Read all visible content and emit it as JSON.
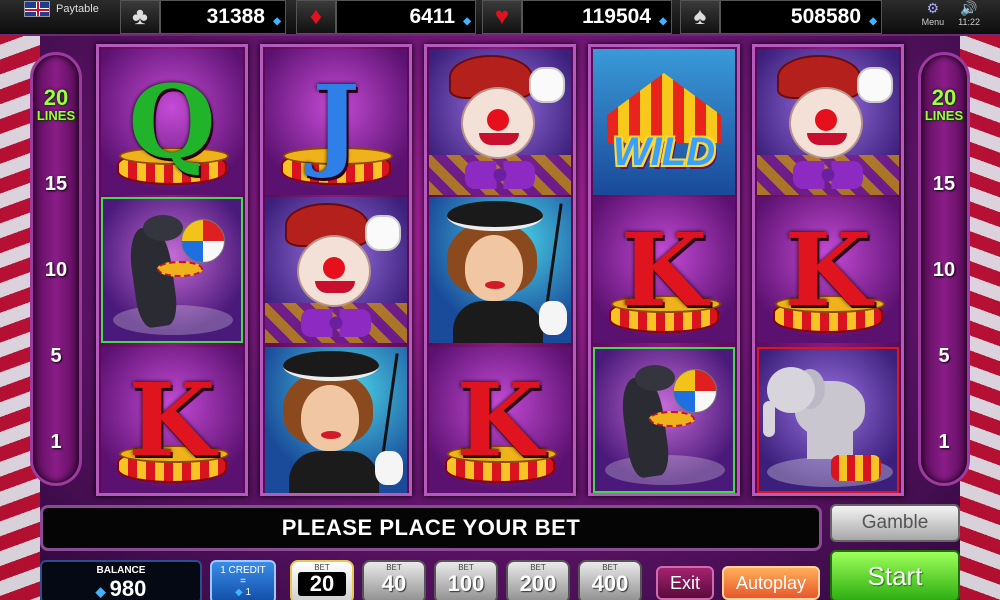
{
  "top_bar": {
    "language_label": "Paytable",
    "language_sub": "",
    "jackpots": [
      {
        "suit": "clubs",
        "symbol": "♣",
        "value": "31388"
      },
      {
        "suit": "diamonds",
        "symbol": "♦",
        "value": "6411"
      },
      {
        "suit": "hearts",
        "symbol": "♥",
        "value": "119504"
      },
      {
        "suit": "spades",
        "symbol": "♠",
        "value": "508580"
      }
    ],
    "time": "11:22",
    "menu_label": "Menu"
  },
  "lines": {
    "count": "20",
    "label": "LINES",
    "markers": [
      "15",
      "10",
      "5",
      "1"
    ]
  },
  "reels": [
    [
      "Q",
      "seal",
      "K"
    ],
    [
      "J",
      "clown",
      "lady"
    ],
    [
      "clown",
      "lady",
      "K"
    ],
    [
      "wild",
      "K",
      "seal"
    ],
    [
      "clown",
      "K",
      "elephant"
    ]
  ],
  "symbols": {
    "wild_text": "WILD",
    "letter_colors": {
      "Q": "#21b32a",
      "J": "#2f7fe8",
      "K": "#e0141f"
    }
  },
  "message": "PLEASE PLACE YOUR BET",
  "controls": {
    "gamble_label": "Gamble",
    "start_label": "Start",
    "balance_label": "BALANCE",
    "balance_value": "980",
    "credit_line1": "1 CREDIT",
    "credit_line2": "=",
    "credit_line3": "1",
    "bet_label": "BET",
    "bets": [
      "20",
      "40",
      "100",
      "200",
      "400"
    ],
    "active_bet": "20",
    "exit_label": "Exit",
    "autoplay_label": "Autoplay"
  }
}
